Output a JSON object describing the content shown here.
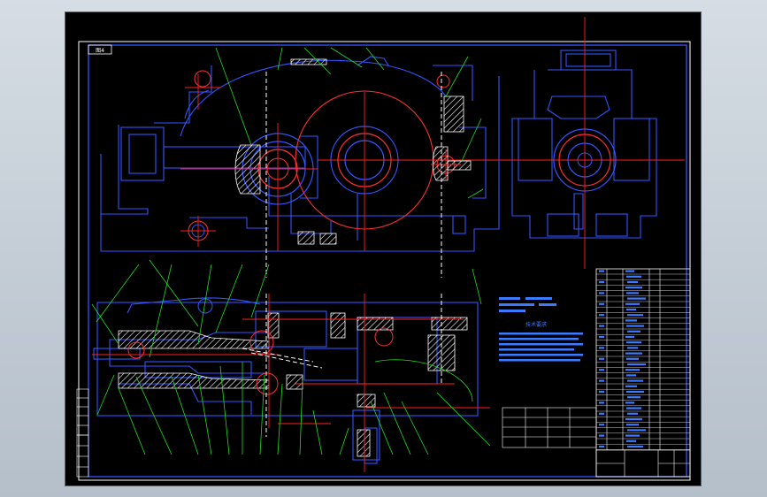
{
  "drawing": {
    "sheet_tag": "图4",
    "tech_notes_title": "技术要求",
    "colors": {
      "background": "#000000",
      "frame": "#ffffff",
      "outline": "#3355ff",
      "center_line": "#ff2020",
      "leader": "#22dd22",
      "hidden": "#ffffff",
      "hatch": "#ffffff",
      "gear_circle": "#ff3030",
      "text": "#3a7bff"
    }
  }
}
